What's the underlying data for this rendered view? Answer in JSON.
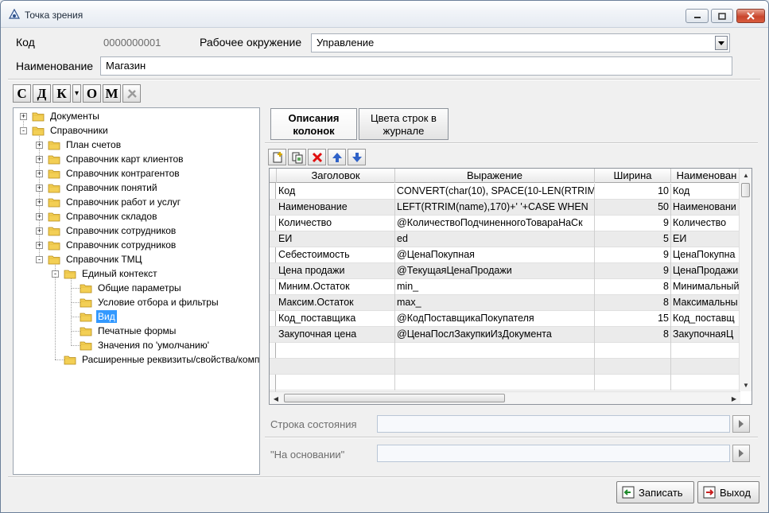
{
  "window": {
    "title": "Точка зрения"
  },
  "form": {
    "code_label": "Код",
    "code_value": "0000000001",
    "env_label": "Рабочее окружение",
    "env_value": "Управление",
    "name_label": "Наименование",
    "name_value": "Магазин"
  },
  "letterbar": [
    "С",
    "Д",
    "К",
    "▾",
    "О",
    "М"
  ],
  "tree": {
    "items": [
      {
        "label": "Документы"
      },
      {
        "label": "Справочники"
      },
      {
        "label": "План счетов"
      },
      {
        "label": "Справочник карт клиентов"
      },
      {
        "label": "Справочник контрагентов"
      },
      {
        "label": "Справочник понятий"
      },
      {
        "label": "Справочник работ и услуг"
      },
      {
        "label": "Справочник складов"
      },
      {
        "label": "Справочник сотрудников"
      },
      {
        "label": "Справочник сотрудников"
      },
      {
        "label": "Справочник ТМЦ"
      },
      {
        "label": "Единый контекст"
      },
      {
        "label": "Общие параметры"
      },
      {
        "label": "Условие отбора и фильтры"
      },
      {
        "label": "Вид"
      },
      {
        "label": "Печатные формы"
      },
      {
        "label": "Значения по 'умолчанию'"
      },
      {
        "label": "Расширенные реквизиты/свойства/комп"
      }
    ]
  },
  "tabs": [
    {
      "line1": "Описания",
      "line2": "колонок"
    },
    {
      "line1": "Цвета строк в",
      "line2": "журнале"
    }
  ],
  "grid": {
    "headers": [
      "Заголовок",
      "Выражение",
      "Ширина",
      "Наименован"
    ],
    "rows": [
      [
        "Код",
        "CONVERT(char(10), SPACE(10-LEN(RTRIM",
        "10",
        "Код"
      ],
      [
        "Наименование",
        "LEFT(RTRIM(name),170)+' '+CASE WHEN",
        "50",
        "Наименовани"
      ],
      [
        "Количество",
        "@КоличествоПодчиненногоТовараНаСк",
        "9",
        "Количество"
      ],
      [
        "ЕИ",
        "ed",
        "5",
        "ЕИ"
      ],
      [
        "Себестоимость",
        "@ЦенаПокупная",
        "9",
        "ЦенаПокупна"
      ],
      [
        "Цена продажи",
        "@ТекущаяЦенаПродажи",
        "9",
        "ЦенаПродажи"
      ],
      [
        "Миним.Остаток",
        "min_",
        "8",
        "Минимальный"
      ],
      [
        "Максим.Остаток",
        "max_",
        "8",
        "Максимальны"
      ],
      [
        "Код_поставщика",
        "@КодПоставщикаПокупателя",
        "15",
        "Код_поставщ"
      ],
      [
        "Закупочная цена",
        "@ЦенаПослЗакупкиИзДокумента",
        "8",
        "ЗакупочнаяЦ"
      ]
    ]
  },
  "status": {
    "status_label": "Строка состояния",
    "basis_label": "\"На основании\""
  },
  "buttons": {
    "save_label": "Записать",
    "exit_label": "Выход"
  }
}
